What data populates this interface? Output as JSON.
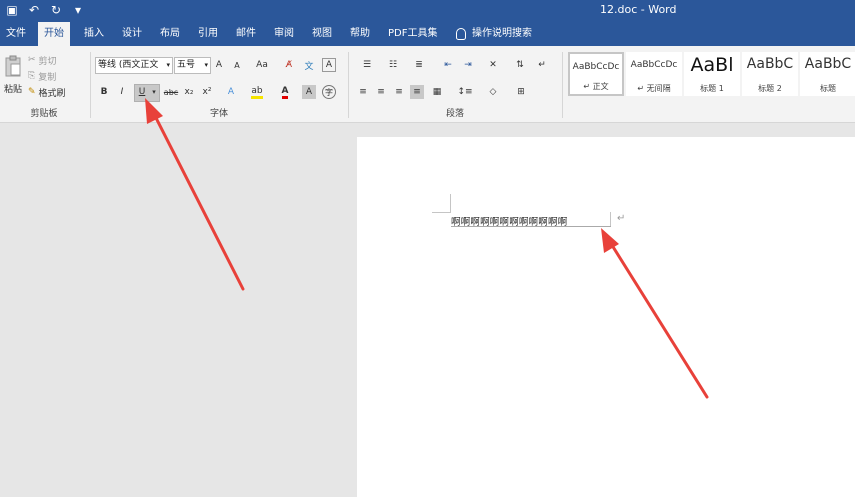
{
  "titlebar": {
    "qat": [
      {
        "icon": "save-icon",
        "glyph": "▣"
      },
      {
        "icon": "undo-icon",
        "glyph": "↶"
      },
      {
        "icon": "redo-icon",
        "glyph": "↻"
      },
      {
        "icon": "customize-qat-icon",
        "glyph": "▾"
      }
    ],
    "document_title": "12.doc  -  Word"
  },
  "tabs": [
    "文件",
    "开始",
    "插入",
    "设计",
    "布局",
    "引用",
    "邮件",
    "审阅",
    "视图",
    "帮助",
    "PDF工具集"
  ],
  "active_tab": "开始",
  "tell_me": "操作说明搜索",
  "clipboard": {
    "paste": "粘贴",
    "cut": "剪切",
    "copy": "复制",
    "format_painter": "格式刷",
    "label": "剪贴板"
  },
  "font": {
    "font_name": "等线 (西文正文",
    "font_size": "五号",
    "bold": "B",
    "italic": "I",
    "underline": "U",
    "strikethrough": "abc",
    "subscript": "x₂",
    "superscript": "x²",
    "grow": "A",
    "shrink": "A",
    "change_case": "Aa",
    "label": "字体"
  },
  "paragraph": {
    "label": "段落"
  },
  "styles": [
    {
      "preview": "AaBbCcDc",
      "name": "↵ 正文",
      "size": 9,
      "selected": true
    },
    {
      "preview": "AaBbCcDc",
      "name": "↵ 无间隔",
      "size": 9,
      "selected": false
    },
    {
      "preview": "AaBl",
      "name": "标题 1",
      "size": 19,
      "selected": false
    },
    {
      "preview": "AaBbC",
      "name": "标题 2",
      "size": 14,
      "selected": false
    },
    {
      "preview": "AaBbC",
      "name": "标题",
      "size": 14,
      "selected": false
    }
  ],
  "document": {
    "text": "啊啊啊啊啊啊啊啊啊啊啊啊",
    "paragraph_mark": "↵"
  },
  "colors": {
    "accent": "#2b579a",
    "arrow": "#e8413a"
  }
}
